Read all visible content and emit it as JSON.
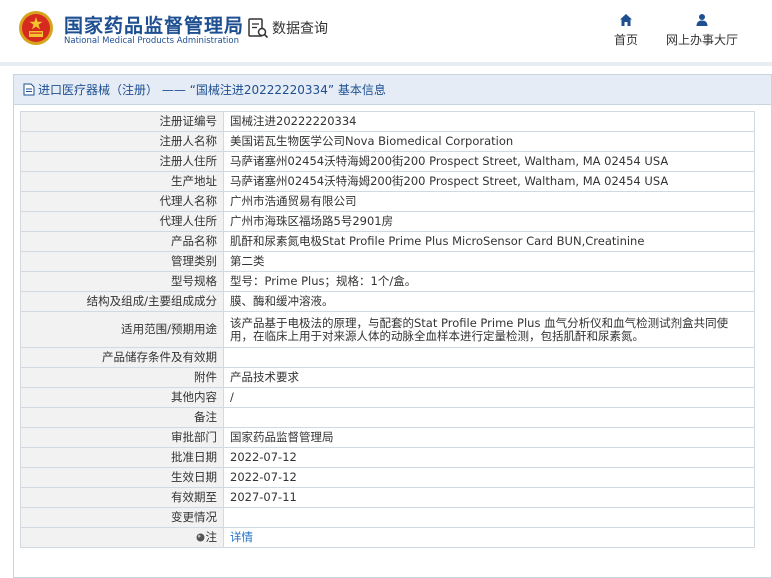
{
  "header": {
    "brand_cn": "国家药品监督管理局",
    "brand_en": "National Medical Products Administration",
    "query_label": "数据查询",
    "nav": {
      "home": "首页",
      "office": "网上办事大厅"
    },
    "icons": {
      "emblem": "national-emblem",
      "query": "database-search-icon",
      "home": "home-icon",
      "office": "user-icon"
    }
  },
  "panel": {
    "title": "进口医疗器械（注册） —— “国械注进20222220334” 基本信息",
    "icon": "document-icon"
  },
  "fields": [
    {
      "label": "注册证编号",
      "value": "国械注进20222220334"
    },
    {
      "label": "注册人名称",
      "value": "美国诺瓦生物医学公司Nova Biomedical Corporation"
    },
    {
      "label": "注册人住所",
      "value": "马萨诸塞州02454沃特海姆200街200 Prospect Street, Waltham, MA 02454 USA"
    },
    {
      "label": "生产地址",
      "value": "马萨诸塞州02454沃特海姆200街200 Prospect Street, Waltham, MA 02454 USA"
    },
    {
      "label": "代理人名称",
      "value": "广州市浩通贸易有限公司"
    },
    {
      "label": "代理人住所",
      "value": "广州市海珠区福场路5号2901房"
    },
    {
      "label": "产品名称",
      "value": "肌酐和尿素氮电极Stat Profile Prime Plus MicroSensor Card BUN,Creatinine"
    },
    {
      "label": "管理类别",
      "value": "第二类"
    },
    {
      "label": "型号规格",
      "value": "型号：Prime Plus；规格：1个/盒。"
    },
    {
      "label": "结构及组成/主要组成成分",
      "value": "膜、酶和缓冲溶液。"
    },
    {
      "label": "适用范围/预期用途",
      "value": "该产品基于电极法的原理，与配套的Stat Profile Prime Plus 血气分析仪和血气检测试剂盒共同使用，在临床上用于对来源人体的动脉全血样本进行定量检测，包括肌酐和尿素氮。"
    },
    {
      "label": "产品储存条件及有效期",
      "value": ""
    },
    {
      "label": "附件",
      "value": "产品技术要求"
    },
    {
      "label": "其他内容",
      "value": "/"
    },
    {
      "label": "备注",
      "value": ""
    },
    {
      "label": "审批部门",
      "value": "国家药品监督管理局"
    },
    {
      "label": "批准日期",
      "value": "2022-07-12"
    },
    {
      "label": "生效日期",
      "value": "2022-07-12"
    },
    {
      "label": "有效期至",
      "value": "2027-07-11"
    },
    {
      "label": "变更情况",
      "value": ""
    },
    {
      "label": "注",
      "value": "详情"
    }
  ]
}
